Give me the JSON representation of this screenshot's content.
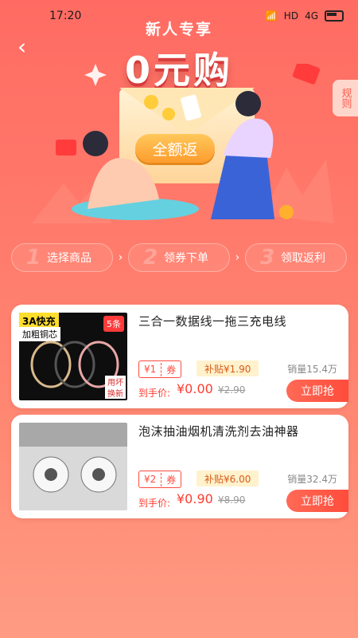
{
  "status_bar": {
    "time": "17:20",
    "network": "HD",
    "signal": "4G"
  },
  "header": {
    "subtitle": "新人专享",
    "title": "0元购",
    "rules_tab": "规则"
  },
  "hero": {
    "badge": "全额返"
  },
  "steps": [
    {
      "num": "1",
      "label": "选择商品"
    },
    {
      "num": "2",
      "label": "领券下单"
    },
    {
      "num": "3",
      "label": "领取返利"
    }
  ],
  "products": [
    {
      "title": "三合一数据线一拖三充电线",
      "coupon_amount": "¥1",
      "coupon_label": "券",
      "subsidy": "补贴¥1.90",
      "sales": "销量15.4万",
      "price_label": "到手价:",
      "price": "¥0.00",
      "original_price": "¥2.90",
      "buy_label": "立即抢",
      "thumb_text": {
        "tl": "3A快充",
        "tl2": "加粗铜芯",
        "tr": "5条",
        "br1": "用坏",
        "br2": "换新"
      }
    },
    {
      "title": "泡沫抽油烟机清洗剂去油神器",
      "coupon_amount": "¥2",
      "coupon_label": "券",
      "subsidy": "补贴¥6.00",
      "sales": "销量32.4万",
      "price_label": "到手价:",
      "price": "¥0.90",
      "original_price": "¥8.90",
      "buy_label": "立即抢"
    }
  ],
  "colors": {
    "primary": "#ff5a4c",
    "accent": "#ffc85b"
  }
}
